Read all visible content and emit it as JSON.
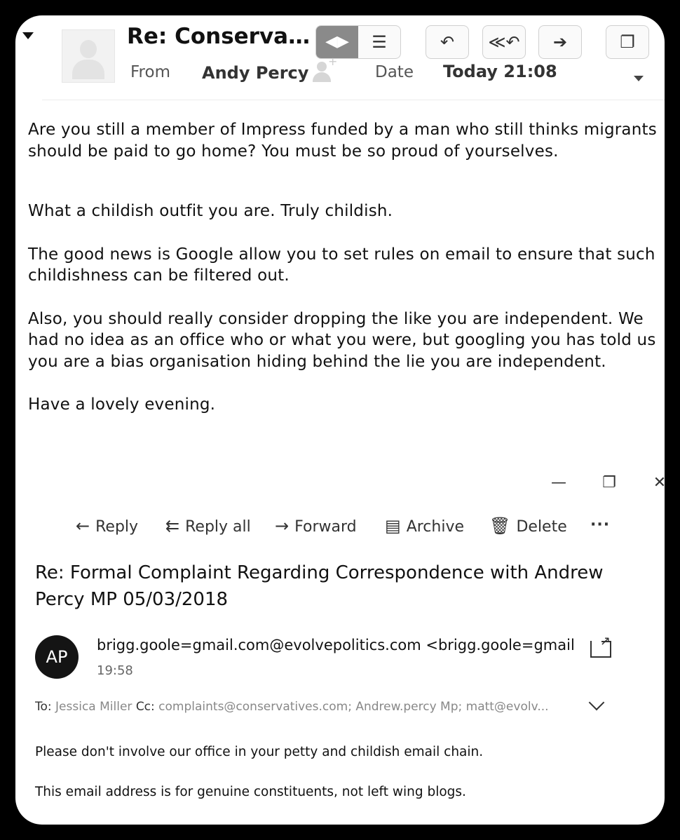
{
  "mail1": {
    "subject": "Re: Conservati…",
    "from_label": "From",
    "from_value": "Andy Percy",
    "date_label": "Date",
    "date_value": "Today 21:08",
    "toolbar_icons": [
      "view-toggle-icon",
      "list-icon",
      "reply-icon",
      "reply-all-icon",
      "forward-icon",
      "window-icon"
    ],
    "body": [
      "Are you still a member of Impress funded by a man who still thinks migrants should be paid to go home? You must be so proud of yourselves.",
      "What a childish outfit you are. Truly childish.",
      "The good news is Google allow you to set rules on email to ensure that such childishness can be filtered out.",
      "Also, you should really consider dropping the like you are independent. We had no idea as an office who or what you were, but googling you has told us you are a bias organisation hiding behind the lie you are independent.",
      "Have a lovely evening."
    ]
  },
  "mail2": {
    "toolbar": {
      "reply": "Reply",
      "reply_all": "Reply all",
      "forward": "Forward",
      "archive": "Archive",
      "delete": "Delete",
      "more": "···"
    },
    "subject": "Re: Formal Complaint Regarding Correspondence with Andrew Percy MP 05/03/2018",
    "avatar_initials": "AP",
    "sender": "brigg.goole=gmail.com@evolvepolitics.com <brigg.goole=gmail",
    "time": "19:58",
    "to_label": "To:",
    "to_value": "Jessica Miller",
    "cc_label": "Cc:",
    "cc_value": "complaints@conservatives.com; Andrew.percy Mp; matt@evolv...",
    "body": [
      "Please don't involve our office in your petty and childish email chain.",
      "This email address is for genuine constituents, not left wing blogs."
    ]
  }
}
